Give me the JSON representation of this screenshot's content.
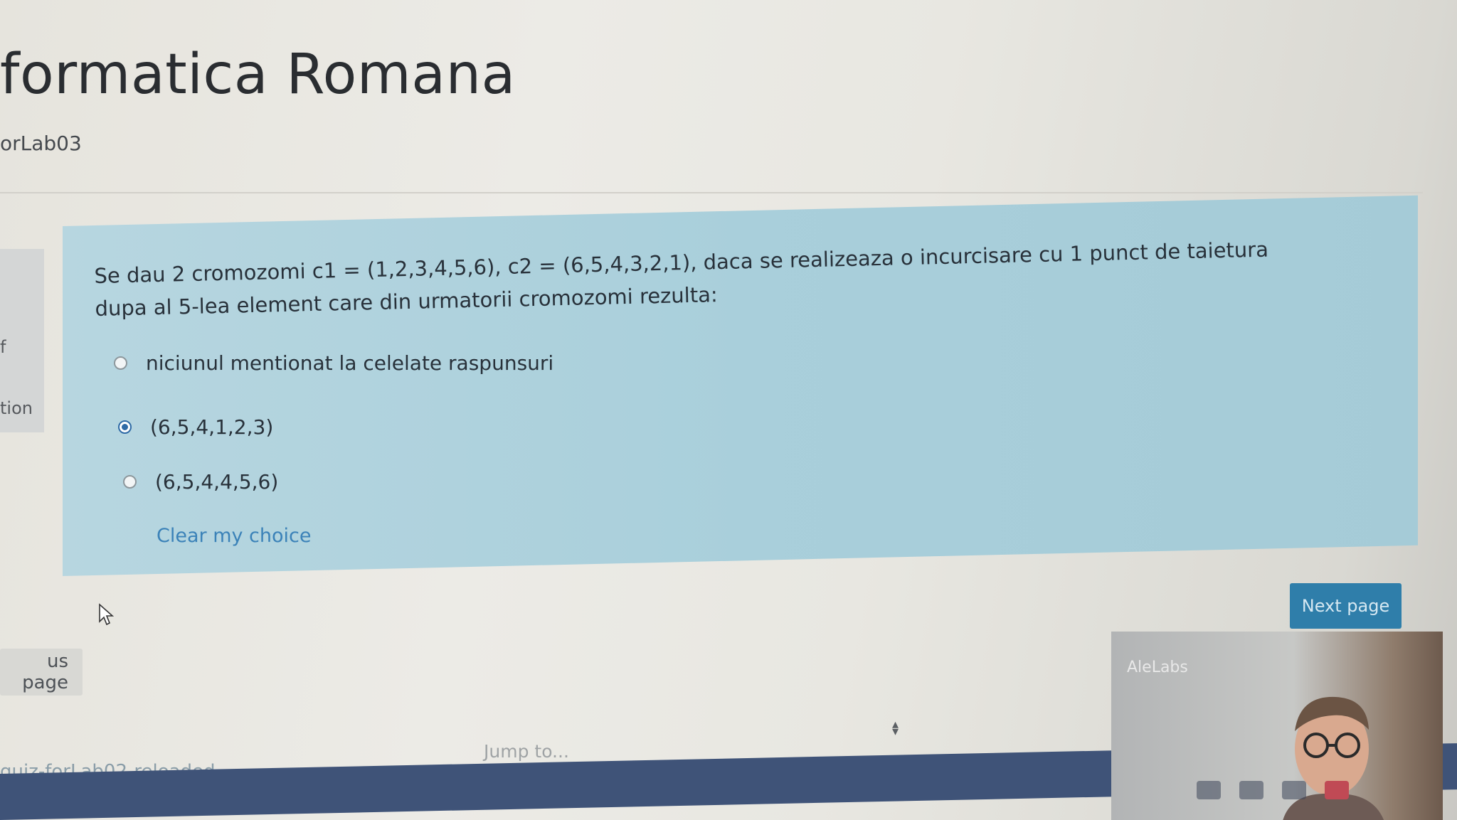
{
  "page": {
    "title": "formatica Romana",
    "breadcrumb": "orLab03"
  },
  "sidebar": {
    "flag_label": "f",
    "question_label": "tion"
  },
  "question": {
    "text": "Se dau 2 cromozomi c1 = (1,2,3,4,5,6), c2 = (6,5,4,3,2,1), daca se realizeaza o incurcisare cu 1 punct de taietura dupa al 5-lea element care din urmatorii cromozomi rezulta:",
    "options": [
      {
        "label": "niciunul mentionat la celelate raspunsuri",
        "selected": false
      },
      {
        "label": "(6,5,4,1,2,3)",
        "selected": true
      },
      {
        "label": "(6,5,4,4,5,6)",
        "selected": false
      }
    ],
    "clear_label": "Clear my choice"
  },
  "navigation": {
    "next_label": "Next page",
    "prev_label": "us page",
    "prev_activity": "quiz-forLab02-reloaded",
    "jump_placeholder": "Jump to..."
  },
  "video": {
    "participant_name": "AleLabs"
  },
  "colors": {
    "accent": "#2f7eaa",
    "panel": "#aed1dc",
    "bottom_bar": "#3f5378"
  }
}
